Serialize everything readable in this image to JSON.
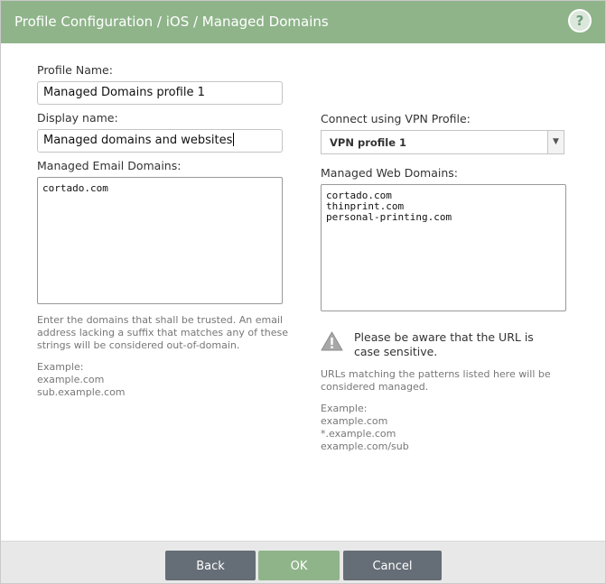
{
  "dialog": {
    "title": "Profile Configuration / iOS / Managed Domains",
    "help_label": "?"
  },
  "left": {
    "profile_name_label": "Profile Name:",
    "profile_name_value": "Managed Domains profile 1",
    "display_name_label": "Display name:",
    "display_name_value": "Managed domains and websites",
    "email_domains_label": "Managed Email Domains:",
    "email_domains": [
      "cortado.com"
    ],
    "help_lines": [
      "Enter the domains that shall be trusted. An email",
      "address lacking a suffix that matches any of these",
      "strings will be considered out-of-domain."
    ],
    "example_lines": [
      "Example:",
      "example.com",
      "sub.example.com"
    ]
  },
  "right": {
    "vpn_label": "Connect using VPN Profile:",
    "vpn_selected": "VPN profile 1",
    "web_domains_label": "Managed Web Domains:",
    "web_domains": [
      "cortado.com",
      "thinprint.com",
      "personal-printing.com"
    ],
    "warning_lines": [
      "Please be aware that the URL is",
      "case sensitive."
    ],
    "help_lines": [
      "URLs matching the patterns listed here will be",
      "considered managed."
    ],
    "example_lines": [
      "Example:",
      "example.com",
      "*.example.com",
      "example.com/sub"
    ]
  },
  "footer": {
    "back_label": "Back",
    "ok_label": "OK",
    "cancel_label": "Cancel"
  },
  "colors": {
    "header_bg": "#8fb48a",
    "ok_button": "#8fb48a",
    "secondary_button": "#656d76",
    "footer_bg": "#e8e8e8"
  },
  "icons": {
    "help": "help-icon",
    "warning": "warning-icon",
    "dropdown": "chevron-down-icon"
  }
}
